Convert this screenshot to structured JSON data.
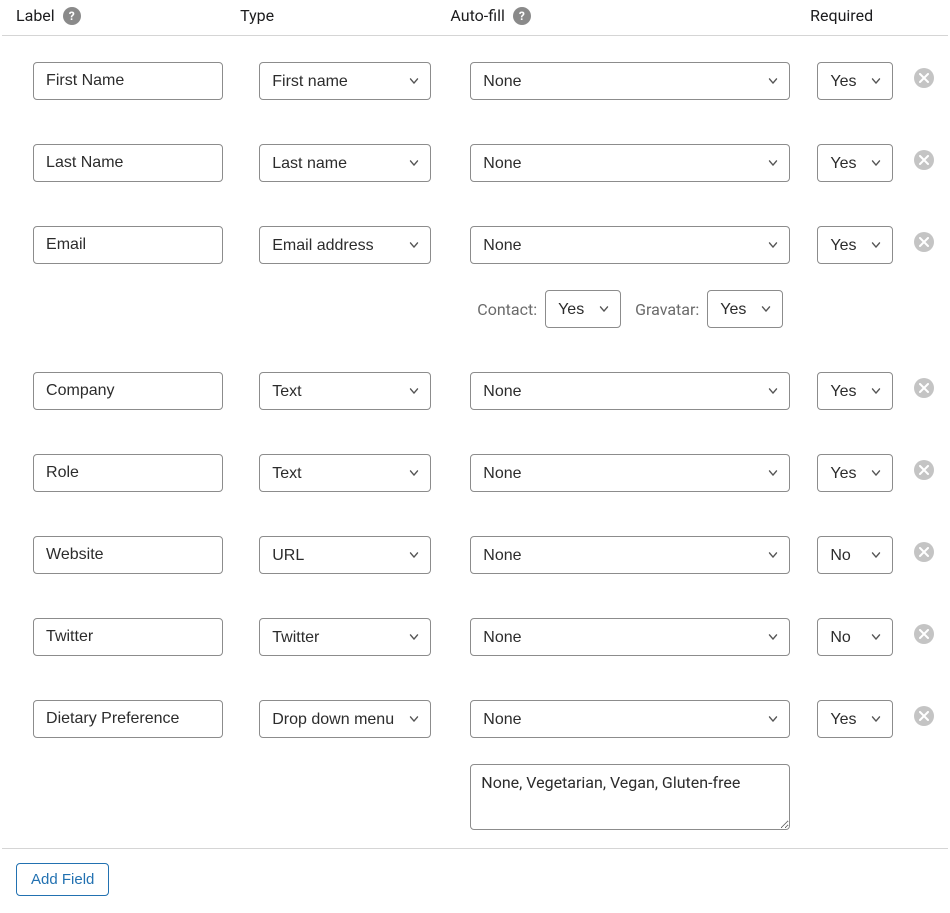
{
  "headers": {
    "label": "Label",
    "type": "Type",
    "autofill": "Auto-fill",
    "required": "Required"
  },
  "rows": [
    {
      "label": "First Name",
      "type": "First name",
      "autofill": "None",
      "required": "Yes"
    },
    {
      "label": "Last Name",
      "type": "Last name",
      "autofill": "None",
      "required": "Yes"
    },
    {
      "label": "Email",
      "type": "Email address",
      "autofill": "None",
      "required": "Yes",
      "email_extras": {
        "contact_label": "Contact:",
        "contact": "Yes",
        "gravatar_label": "Gravatar:",
        "gravatar": "Yes"
      }
    },
    {
      "label": "Company",
      "type": "Text",
      "autofill": "None",
      "required": "Yes"
    },
    {
      "label": "Role",
      "type": "Text",
      "autofill": "None",
      "required": "Yes"
    },
    {
      "label": "Website",
      "type": "URL",
      "autofill": "None",
      "required": "No"
    },
    {
      "label": "Twitter",
      "type": "Twitter",
      "autofill": "None",
      "required": "No"
    },
    {
      "label": "Dietary Preference",
      "type": "Drop down menu",
      "autofill": "None",
      "required": "Yes",
      "options_text": "None, Vegetarian, Vegan, Gluten-free"
    }
  ],
  "add_field_label": "Add Field"
}
